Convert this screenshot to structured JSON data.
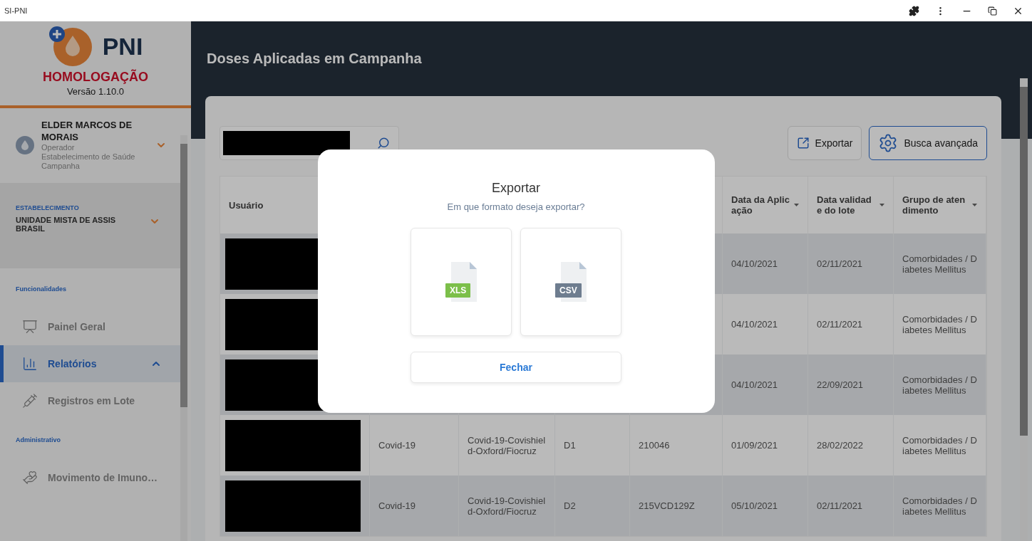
{
  "window": {
    "title": "SI-PNI"
  },
  "sidebar": {
    "brand": "PNI",
    "environment": "HOMOLOGAÇÃO",
    "version": "Versão 1.10.0",
    "user": {
      "name": "ELDER MARCOS DE MORAIS",
      "role": "Operador",
      "unit": "Estabelecimento de Saúde Campanha"
    },
    "establishment": {
      "label": "ESTABELECIMENTO",
      "value": "UNIDADE MISTA DE ASSIS BRASIL"
    },
    "sections": [
      {
        "title": "Funcionalidades",
        "items": [
          {
            "kind": "panel",
            "label": "Painel Geral",
            "selected": false
          },
          {
            "kind": "reports",
            "label": "Relatórios",
            "selected": true,
            "expanded": true
          },
          {
            "kind": "batch",
            "label": "Registros em Lote",
            "selected": false
          }
        ]
      },
      {
        "title": "Administrativo",
        "items": [
          {
            "kind": "movement",
            "label": "Movimento de Imuno…",
            "selected": false
          }
        ]
      }
    ]
  },
  "page": {
    "title": "Doses Aplicadas em Campanha"
  },
  "toolbar": {
    "buttons": [
      {
        "kind": "export",
        "label": "Exportar"
      },
      {
        "kind": "advanced",
        "label": "Busca avançada"
      }
    ]
  },
  "table": {
    "headers": {
      "usuario": "Usuário",
      "data_aplicacao": "Data da Aplicação",
      "data_validade_lote": "Data validade do lote",
      "grupo_atendimento": "Grupo de atendimento"
    },
    "rows": [
      {
        "data_aplicacao": "04/10/2021",
        "data_validade_lote": "02/11/2021",
        "grupo_atendimento": "Comorbidades / Diabetes Mellitus"
      },
      {
        "data_aplicacao": "04/10/2021",
        "data_validade_lote": "02/11/2021",
        "grupo_atendimento": "Comorbidades / Diabetes Mellitus"
      },
      {
        "data_aplicacao": "04/10/2021",
        "data_validade_lote": "22/09/2021",
        "grupo_atendimento": "Comorbidades / Diabetes Mellitus"
      },
      {
        "column_2": "Covid-19",
        "column_3": "Covid-19-Covishield-Oxford/Fiocruz",
        "column_4": "D1",
        "column_5": "210046",
        "data_aplicacao": "01/09/2021",
        "data_validade_lote": "28/02/2022",
        "grupo_atendimento": "Comorbidades / Diabetes Mellitus"
      },
      {
        "column_2": "Covid-19",
        "column_3": "Covid-19-Covishield-Oxford/Fiocruz",
        "column_4": "D2",
        "column_5": "215VCD129Z",
        "data_aplicacao": "05/10/2021",
        "data_validade_lote": "02/11/2021",
        "grupo_atendimento": "Comorbidades / Diabetes Mellitus"
      }
    ]
  },
  "dialog": {
    "title": "Exportar",
    "subtitle": "Em que formato deseja exportar?",
    "formats": [
      {
        "label": "XLS",
        "color": "#7cbf4a"
      },
      {
        "label": "CSV",
        "color": "#6e7d8f"
      }
    ],
    "close": "Fechar"
  }
}
